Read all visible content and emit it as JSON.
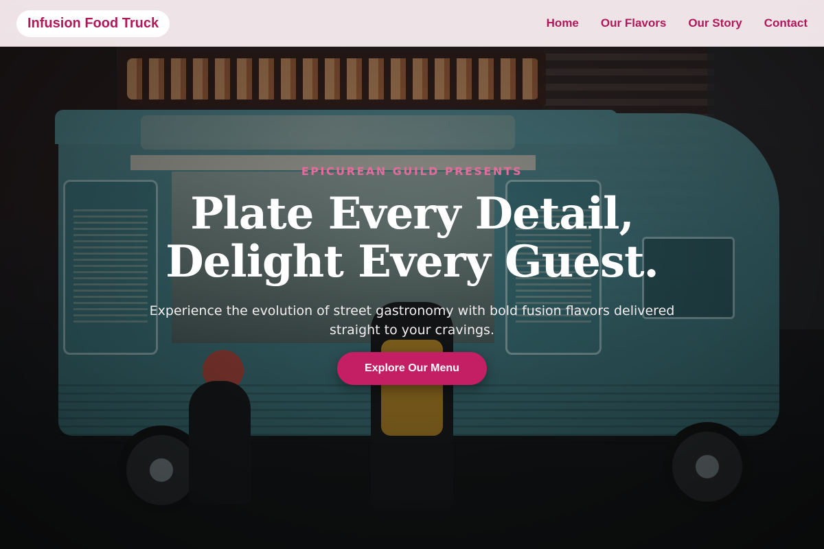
{
  "nav": {
    "brand": "Infusion Food Truck",
    "links": [
      {
        "label": "Home"
      },
      {
        "label": "Our Flavors"
      },
      {
        "label": "Our Story"
      },
      {
        "label": "Contact"
      }
    ]
  },
  "hero": {
    "eyebrow": "EPICUREAN GUILD PRESENTS",
    "headline_line1": "Plate Every Detail,",
    "headline_line2": "Delight Every Guest.",
    "subtext": "Experience the evolution of street gastronomy with bold fusion flavors delivered straight to your cravings.",
    "cta_label": "Explore Our Menu"
  },
  "colors": {
    "accent": "#c41e65",
    "nav_text": "#b0185a",
    "eyebrow": "#e46b9c"
  }
}
